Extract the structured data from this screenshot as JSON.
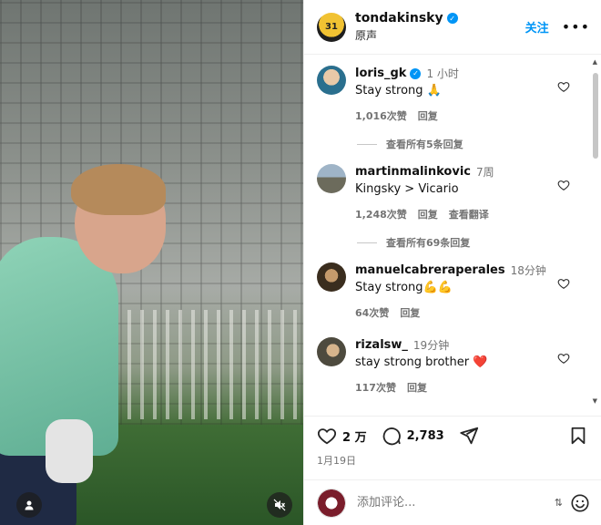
{
  "post": {
    "username": "tondakinsky",
    "audio": "原声",
    "follow_label": "关注",
    "more_label": "•••"
  },
  "comments": [
    {
      "username": "loris_gk",
      "verified": true,
      "time": "1 小时",
      "text": "Stay strong 🙏",
      "likes": "1,016次赞",
      "reply_label": "回复",
      "view_replies": "查看所有5条回复"
    },
    {
      "username": "martinmalinkovic",
      "verified": false,
      "time": "7周",
      "text": "Kingsky > Vicario",
      "likes": "1,248次赞",
      "reply_label": "回复",
      "translate_label": "查看翻译",
      "view_replies": "查看所有69条回复"
    },
    {
      "username": "manuelcabreraperales",
      "verified": false,
      "time": "18分钟",
      "text": "Stay strong💪💪",
      "likes": "64次赞",
      "reply_label": "回复"
    },
    {
      "username": "rizalsw_",
      "verified": false,
      "time": "19分钟",
      "text": "stay strong brother ❤️",
      "likes": "117次赞",
      "reply_label": "回复"
    }
  ],
  "actions": {
    "like_count": "2 万",
    "comment_count": "2,783",
    "date": "1月19日"
  },
  "composer": {
    "placeholder": "添加评论..."
  },
  "colors": {
    "accent": "#0095f6",
    "heart_red": "#ed4956"
  }
}
